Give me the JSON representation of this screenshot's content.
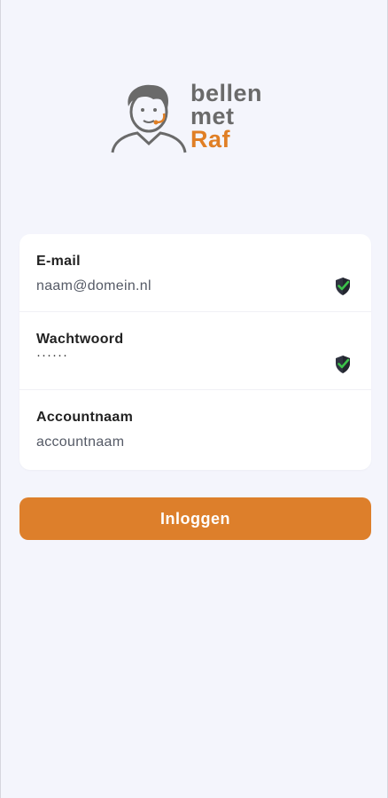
{
  "brand": {
    "line1": "bellen",
    "line2": "met",
    "line3": "Raf",
    "dark_color": "#6a6a6a",
    "accent_color": "#e07f25"
  },
  "form": {
    "email": {
      "label": "E-mail",
      "value": "naam@domein.nl",
      "status_icon": "shield-check-icon"
    },
    "password": {
      "label": "Wachtwoord",
      "value": "······",
      "status_icon": "shield-check-icon"
    },
    "account": {
      "label": "Accountnaam",
      "value": "accountnaam"
    }
  },
  "login_button": {
    "label": "Inloggen",
    "color": "#dd7f2b"
  }
}
